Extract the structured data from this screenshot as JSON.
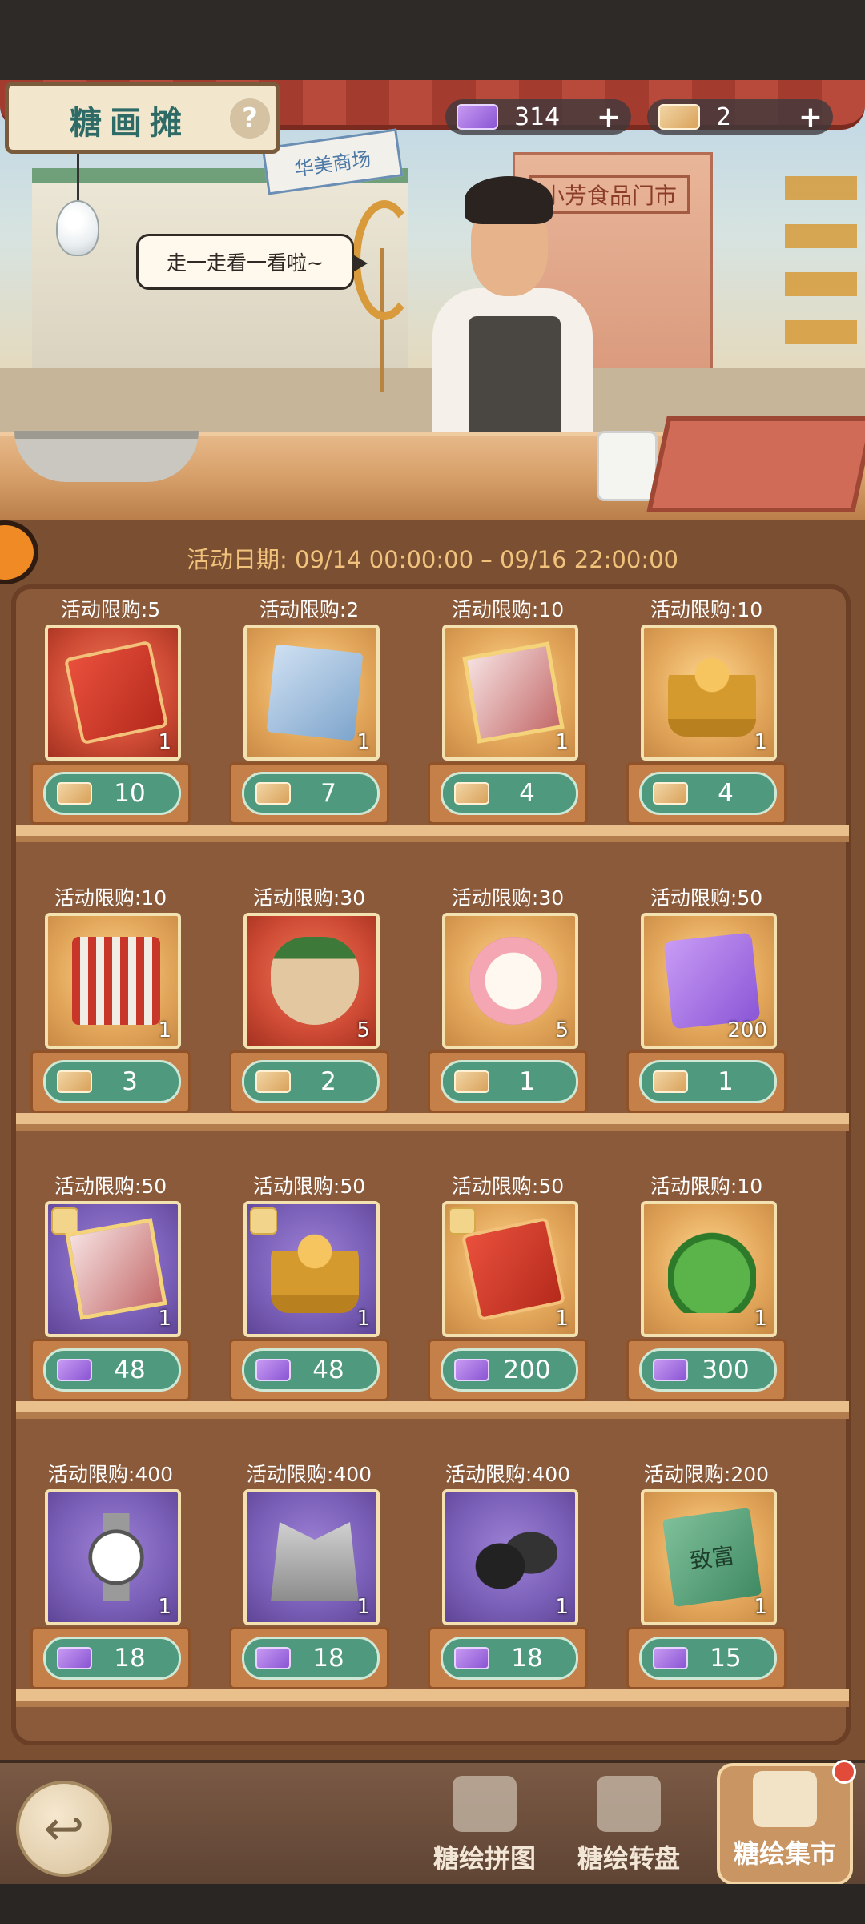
{
  "header": {
    "title": "糖画摊",
    "help": "?",
    "speech": "走一走看一看啦~",
    "currency": [
      {
        "icon": "coupon-icon",
        "value": "314",
        "plus": "+"
      },
      {
        "icon": "ticket-icon",
        "value": "2",
        "plus": "+"
      }
    ],
    "scene_signs": {
      "shop": "华美商场",
      "store": "小芳食品门市"
    }
  },
  "event": {
    "date_text": "活动日期: 09/14 00:00:00 – 09/16 22:00:00"
  },
  "limit_prefix": "活动限购:",
  "shelves": [
    {
      "items": [
        {
          "name": "talent-card",
          "box": "red",
          "art": "art-card",
          "qty": "1",
          "limit": "5",
          "price": "10",
          "currency": "ticket",
          "puzzle": false
        },
        {
          "name": "book",
          "box": "gold",
          "art": "art-book",
          "qty": "1",
          "limit": "2",
          "price": "7",
          "currency": "ticket",
          "puzzle": false
        },
        {
          "name": "photo-card",
          "box": "gold",
          "art": "art-photo",
          "qty": "1",
          "limit": "10",
          "price": "4",
          "currency": "ticket",
          "puzzle": false
        },
        {
          "name": "golden-statue",
          "box": "gold",
          "art": "art-statue",
          "qty": "1",
          "limit": "10",
          "price": "4",
          "currency": "ticket",
          "puzzle": false
        }
      ]
    },
    {
      "items": [
        {
          "name": "car-cage",
          "box": "gold",
          "art": "art-cage",
          "qty": "1",
          "limit": "10",
          "price": "3",
          "currency": "ticket",
          "puzzle": false
        },
        {
          "name": "ginseng",
          "box": "red",
          "art": "art-root",
          "qty": "5",
          "limit": "30",
          "price": "2",
          "currency": "ticket",
          "puzzle": false
        },
        {
          "name": "compact",
          "box": "gold",
          "art": "art-compact",
          "qty": "5",
          "limit": "30",
          "price": "1",
          "currency": "ticket",
          "puzzle": false
        },
        {
          "name": "purple-coupon",
          "box": "gold",
          "art": "art-ticket",
          "qty": "200",
          "limit": "50",
          "price": "1",
          "currency": "ticket",
          "puzzle": false
        }
      ]
    },
    {
      "items": [
        {
          "name": "photo-card-puzzle",
          "box": "purple",
          "art": "art-photo",
          "qty": "1",
          "limit": "50",
          "price": "48",
          "currency": "coupon",
          "puzzle": true
        },
        {
          "name": "golden-statue-puzzle",
          "box": "purple",
          "art": "art-statue",
          "qty": "1",
          "limit": "50",
          "price": "48",
          "currency": "coupon",
          "puzzle": true
        },
        {
          "name": "talent-card-puzzle",
          "box": "gold",
          "art": "art-card",
          "qty": "1",
          "limit": "50",
          "price": "200",
          "currency": "coupon",
          "puzzle": true
        },
        {
          "name": "green-flask",
          "box": "gold",
          "art": "art-flask",
          "qty": "1",
          "limit": "10",
          "price": "300",
          "currency": "coupon",
          "puzzle": false
        }
      ]
    },
    {
      "items": [
        {
          "name": "wristwatch",
          "box": "purple",
          "art": "art-watch",
          "qty": "1",
          "limit": "400",
          "price": "18",
          "currency": "coupon",
          "puzzle": false
        },
        {
          "name": "suit",
          "box": "purple",
          "art": "art-suit",
          "qty": "1",
          "limit": "400",
          "price": "18",
          "currency": "coupon",
          "puzzle": false
        },
        {
          "name": "leather-shoes",
          "box": "purple",
          "art": "art-shoes",
          "qty": "1",
          "limit": "400",
          "price": "18",
          "currency": "coupon",
          "puzzle": false
        },
        {
          "name": "fortune-book",
          "box": "gold",
          "art": "art-greenbook",
          "qty": "1",
          "limit": "200",
          "price": "15",
          "currency": "coupon",
          "puzzle": false,
          "art_text": "致富"
        }
      ]
    }
  ],
  "nav": {
    "back_icon": "back-arrow-icon",
    "back_glyph": "↩",
    "tabs": [
      {
        "label": "糖绘拼图",
        "icon": "puzzle-icon",
        "active": false
      },
      {
        "label": "糖绘转盘",
        "icon": "wheel-icon",
        "active": false
      },
      {
        "label": "糖绘集市",
        "icon": "market-icon",
        "active": true,
        "badge": true
      }
    ]
  },
  "colors": {
    "price_pill": "#4f9a7e",
    "date_text": "#f0c27c",
    "title_text": "#2e6a66"
  }
}
